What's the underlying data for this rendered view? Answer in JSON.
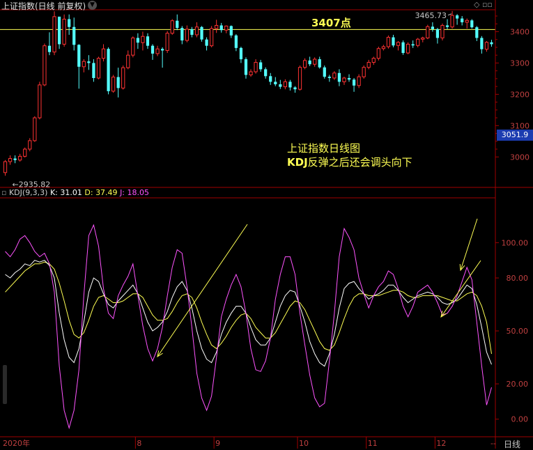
{
  "header": {
    "title": "上证指数(日线 前复权)",
    "kdj_label": "KDJ(9,3,3)",
    "k_text": "K: 31.01",
    "d_text": "D: 37.49",
    "j_text": "J: 18.05",
    "top_right_icons": "◇ ▫▫"
  },
  "price_panel": {
    "ylim": [
      2905,
      3470
    ],
    "ticks": [
      "3000",
      "3100",
      "3200",
      "3300",
      "3400"
    ],
    "tick_values": [
      3000,
      3100,
      3200,
      3300,
      3400
    ],
    "current_price": "3051.9",
    "hline_value": 3407,
    "hline_label": "3407点",
    "high_label": "3465.73",
    "low_label": "2935.82",
    "annotation_line1": "上证指数日线图",
    "annotation_line2_prefix": "KDJ",
    "annotation_line2_rest": "反弹之后还会调头向下"
  },
  "kdj_panel": {
    "ylim": [
      -8,
      125
    ],
    "ticks": [
      "0.00",
      "20.00",
      "50.00",
      "80.00",
      "100.00"
    ],
    "tick_values": [
      0,
      20,
      50,
      80,
      100
    ]
  },
  "x_axis": {
    "labels": [
      "2020年",
      "8",
      "9",
      "10",
      "11",
      "12",
      "--"
    ],
    "label_index": [
      0,
      27,
      43,
      60,
      74,
      88,
      99
    ],
    "period_button": "日线"
  },
  "colors": {
    "up": "#ff3232",
    "down": "#54ffff",
    "K": "#ffffff",
    "D": "#ffff54",
    "J": "#ff54ff",
    "hline": "#ffff54",
    "axis": "#a00000",
    "annotation": "#ffff54"
  },
  "chart_data": {
    "type": "candlestick",
    "title": "上证指数(日线 前复权)",
    "ohlc": [
      [
        2950,
        2990,
        2940,
        2985
      ],
      [
        2985,
        3005,
        2975,
        2995
      ],
      [
        2995,
        3005,
        2980,
        2990
      ],
      [
        2990,
        3010,
        2985,
        3002
      ],
      [
        3002,
        3030,
        2998,
        3025
      ],
      [
        3025,
        3060,
        3018,
        3052
      ],
      [
        3052,
        3130,
        3048,
        3125
      ],
      [
        3125,
        3240,
        3120,
        3230
      ],
      [
        3230,
        3362,
        3226,
        3355
      ],
      [
        3355,
        3398,
        3325,
        3335
      ],
      [
        3335,
        3465,
        3325,
        3448
      ],
      [
        3448,
        3445,
        3345,
        3360
      ],
      [
        3360,
        3455,
        3352,
        3440
      ],
      [
        3440,
        3455,
        3390,
        3415
      ],
      [
        3415,
        3445,
        3340,
        3358
      ],
      [
        3358,
        3360,
        3218,
        3288
      ],
      [
        3288,
        3312,
        3270,
        3305
      ],
      [
        3305,
        3325,
        3278,
        3300
      ],
      [
        3300,
        3312,
        3240,
        3252
      ],
      [
        3252,
        3320,
        3248,
        3315
      ],
      [
        3315,
        3360,
        3305,
        3345
      ],
      [
        3345,
        3350,
        3200,
        3210
      ],
      [
        3210,
        3262,
        3205,
        3255
      ],
      [
        3255,
        3285,
        3190,
        3220
      ],
      [
        3220,
        3292,
        3215,
        3285
      ],
      [
        3285,
        3340,
        3280,
        3325
      ],
      [
        3325,
        3385,
        3318,
        3380
      ],
      [
        3380,
        3395,
        3345,
        3365
      ],
      [
        3365,
        3400,
        3340,
        3385
      ],
      [
        3385,
        3395,
        3345,
        3355
      ],
      [
        3355,
        3360,
        3310,
        3330
      ],
      [
        3330,
        3355,
        3322,
        3345
      ],
      [
        3345,
        3350,
        3285,
        3340
      ],
      [
        3340,
        3402,
        3332,
        3395
      ],
      [
        3395,
        3440,
        3390,
        3435
      ],
      [
        3435,
        3455,
        3405,
        3412
      ],
      [
        3412,
        3418,
        3360,
        3372
      ],
      [
        3372,
        3420,
        3366,
        3408
      ],
      [
        3408,
        3415,
        3382,
        3390
      ],
      [
        3390,
        3430,
        3382,
        3415
      ],
      [
        3415,
        3418,
        3368,
        3375
      ],
      [
        3375,
        3382,
        3340,
        3355
      ],
      [
        3355,
        3418,
        3350,
        3410
      ],
      [
        3410,
        3438,
        3396,
        3420
      ],
      [
        3420,
        3428,
        3397,
        3405
      ],
      [
        3405,
        3420,
        3395,
        3418
      ],
      [
        3418,
        3420,
        3380,
        3388
      ],
      [
        3388,
        3392,
        3338,
        3348
      ],
      [
        3348,
        3352,
        3300,
        3312
      ],
      [
        3312,
        3318,
        3250,
        3262
      ],
      [
        3262,
        3280,
        3256,
        3272
      ],
      [
        3272,
        3312,
        3266,
        3302
      ],
      [
        3302,
        3310,
        3272,
        3280
      ],
      [
        3280,
        3286,
        3250,
        3258
      ],
      [
        3258,
        3268,
        3230,
        3240
      ],
      [
        3240,
        3255,
        3226,
        3232
      ],
      [
        3232,
        3246,
        3217,
        3224
      ],
      [
        3224,
        3248,
        3216,
        3240
      ],
      [
        3240,
        3246,
        3212,
        3222
      ],
      [
        3222,
        3226,
        3205,
        3216
      ],
      [
        3216,
        3292,
        3212,
        3286
      ],
      [
        3286,
        3315,
        3280,
        3308
      ],
      [
        3308,
        3320,
        3290,
        3296
      ],
      [
        3296,
        3318,
        3288,
        3312
      ],
      [
        3312,
        3320,
        3282,
        3286
      ],
      [
        3286,
        3292,
        3250,
        3256
      ],
      [
        3256,
        3262,
        3240,
        3252
      ],
      [
        3252,
        3274,
        3246,
        3268
      ],
      [
        3268,
        3280,
        3226,
        3240
      ],
      [
        3240,
        3256,
        3230,
        3252
      ],
      [
        3252,
        3264,
        3240,
        3247
      ],
      [
        3247,
        3252,
        3208,
        3228
      ],
      [
        3228,
        3264,
        3220,
        3256
      ],
      [
        3256,
        3292,
        3250,
        3286
      ],
      [
        3286,
        3310,
        3280,
        3302
      ],
      [
        3302,
        3320,
        3294,
        3315
      ],
      [
        3315,
        3352,
        3308,
        3346
      ],
      [
        3346,
        3358,
        3340,
        3352
      ],
      [
        3352,
        3388,
        3346,
        3382
      ],
      [
        3382,
        3390,
        3350,
        3356
      ],
      [
        3356,
        3370,
        3340,
        3366
      ],
      [
        3366,
        3372,
        3326,
        3332
      ],
      [
        3332,
        3366,
        3328,
        3360
      ],
      [
        3360,
        3372,
        3348,
        3356
      ],
      [
        3356,
        3380,
        3350,
        3376
      ],
      [
        3376,
        3384,
        3366,
        3380
      ],
      [
        3380,
        3422,
        3376,
        3416
      ],
      [
        3416,
        3430,
        3400,
        3408
      ],
      [
        3408,
        3412,
        3362,
        3380
      ],
      [
        3380,
        3426,
        3372,
        3420
      ],
      [
        3420,
        3440,
        3408,
        3415
      ],
      [
        3415,
        3466,
        3410,
        3452
      ],
      [
        3452,
        3456,
        3422,
        3442
      ],
      [
        3442,
        3450,
        3420,
        3430
      ],
      [
        3430,
        3442,
        3410,
        3436
      ],
      [
        3436,
        3440,
        3410,
        3414
      ],
      [
        3414,
        3418,
        3370,
        3380
      ],
      [
        3380,
        3386,
        3330,
        3344
      ],
      [
        3344,
        3370,
        3336,
        3366
      ],
      [
        3366,
        3374,
        3352,
        3360
      ]
    ],
    "K": [
      82,
      80,
      83,
      85,
      88,
      87,
      90,
      89,
      90,
      87,
      80,
      60,
      45,
      35,
      32,
      40,
      55,
      72,
      80,
      78,
      71,
      65,
      63,
      67,
      70,
      73,
      76,
      71,
      63,
      55,
      50,
      52,
      55,
      61,
      69,
      75,
      78,
      73,
      63,
      50,
      40,
      34,
      32,
      38,
      48,
      55,
      60,
      64,
      64,
      60,
      52,
      45,
      42,
      42,
      46,
      55,
      64,
      70,
      73,
      72,
      64,
      55,
      44,
      37,
      32,
      30,
      37,
      48,
      63,
      74,
      77,
      78,
      74,
      71,
      68,
      70,
      71,
      73,
      76,
      76,
      73,
      69,
      66,
      68,
      70,
      71,
      72,
      71,
      69,
      66,
      65,
      66,
      68,
      72,
      76,
      74,
      65,
      52,
      38,
      31
    ],
    "D": [
      72,
      75,
      78,
      81,
      84,
      86,
      88,
      88,
      89,
      88,
      85,
      77,
      67,
      56,
      48,
      46,
      49,
      56,
      64,
      69,
      70,
      68,
      66,
      66,
      67,
      69,
      71,
      71,
      69,
      64,
      59,
      56,
      56,
      57,
      61,
      66,
      70,
      71,
      69,
      63,
      55,
      48,
      42,
      40,
      43,
      47,
      52,
      56,
      59,
      60,
      57,
      52,
      49,
      46,
      46,
      49,
      54,
      59,
      64,
      67,
      66,
      62,
      56,
      50,
      44,
      40,
      39,
      42,
      49,
      57,
      64,
      69,
      71,
      71,
      70,
      70,
      70,
      71,
      72,
      73,
      73,
      72,
      70,
      69,
      69,
      70,
      70,
      70,
      70,
      69,
      68,
      67,
      67,
      69,
      71,
      72,
      70,
      64,
      55,
      37
    ],
    "J": [
      95,
      92,
      96,
      102,
      104,
      100,
      95,
      92,
      94,
      88,
      72,
      30,
      5,
      -5,
      5,
      28,
      70,
      104,
      110,
      98,
      74,
      60,
      57,
      70,
      76,
      81,
      88,
      70,
      53,
      40,
      33,
      40,
      52,
      70,
      86,
      96,
      94,
      75,
      52,
      26,
      12,
      5,
      13,
      35,
      58,
      68,
      76,
      82,
      75,
      60,
      40,
      28,
      27,
      33,
      46,
      68,
      82,
      92,
      92,
      82,
      60,
      42,
      25,
      12,
      7,
      9,
      33,
      60,
      92,
      108,
      103,
      96,
      80,
      71,
      63,
      70,
      75,
      78,
      84,
      82,
      74,
      64,
      58,
      64,
      72,
      74,
      76,
      72,
      66,
      59,
      60,
      64,
      70,
      78,
      86,
      79,
      55,
      30,
      8,
      18
    ]
  }
}
